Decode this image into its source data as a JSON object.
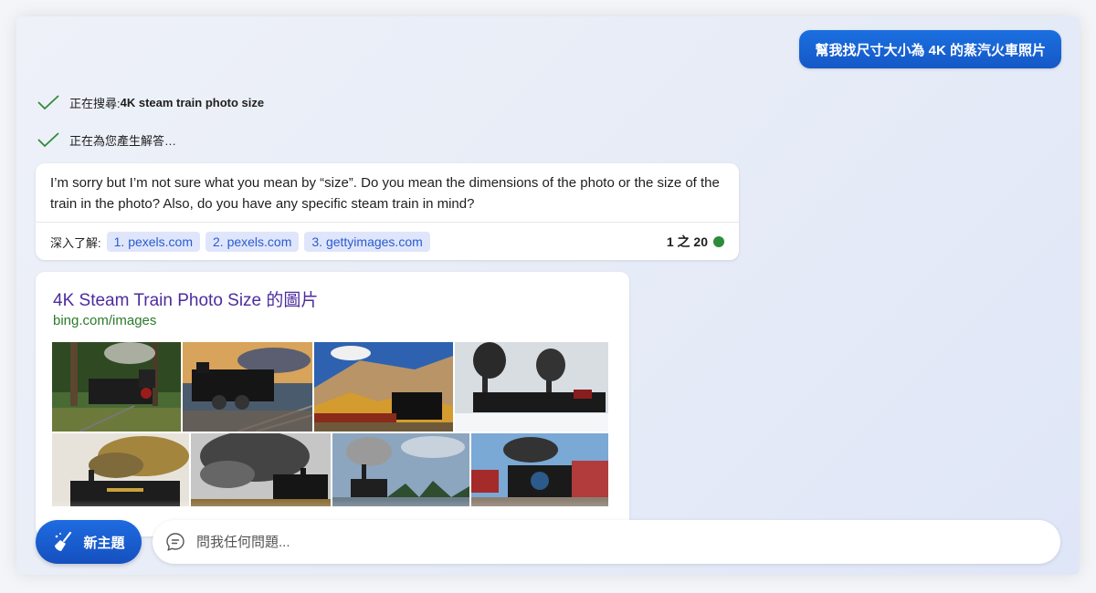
{
  "user_message": "幫我找尺寸大小為 4K 的蒸汽火車照片",
  "status": [
    {
      "label": "正在搜尋: ",
      "query": "4K steam train photo size"
    },
    {
      "label": "正在為您產生解答…",
      "query": ""
    }
  ],
  "answer": {
    "text": "I’m sorry but I’m not sure what you mean by “size”. Do you mean the dimensions of the photo or the size of the train in the photo? Also, do you have any specific steam train in mind?",
    "learn_more_label": "深入了解:",
    "sources": [
      "1. pexels.com",
      "2. pexels.com",
      "3. gettyimages.com"
    ],
    "counter": "1 之 20",
    "counter_color": "#2e8b3a"
  },
  "image_card": {
    "title": "4K Steam Train Photo Size 的圖片",
    "url": "bing.com/images"
  },
  "bottom": {
    "new_topic_label": "新主題",
    "ask_placeholder": "問我任何問題..."
  },
  "colors": {
    "accent": "#1b6fe0",
    "link_title": "#4d2c9e",
    "link_url": "#2b7a2b",
    "chip_bg": "#dfe6fb",
    "chip_text": "#2a5bd0"
  }
}
